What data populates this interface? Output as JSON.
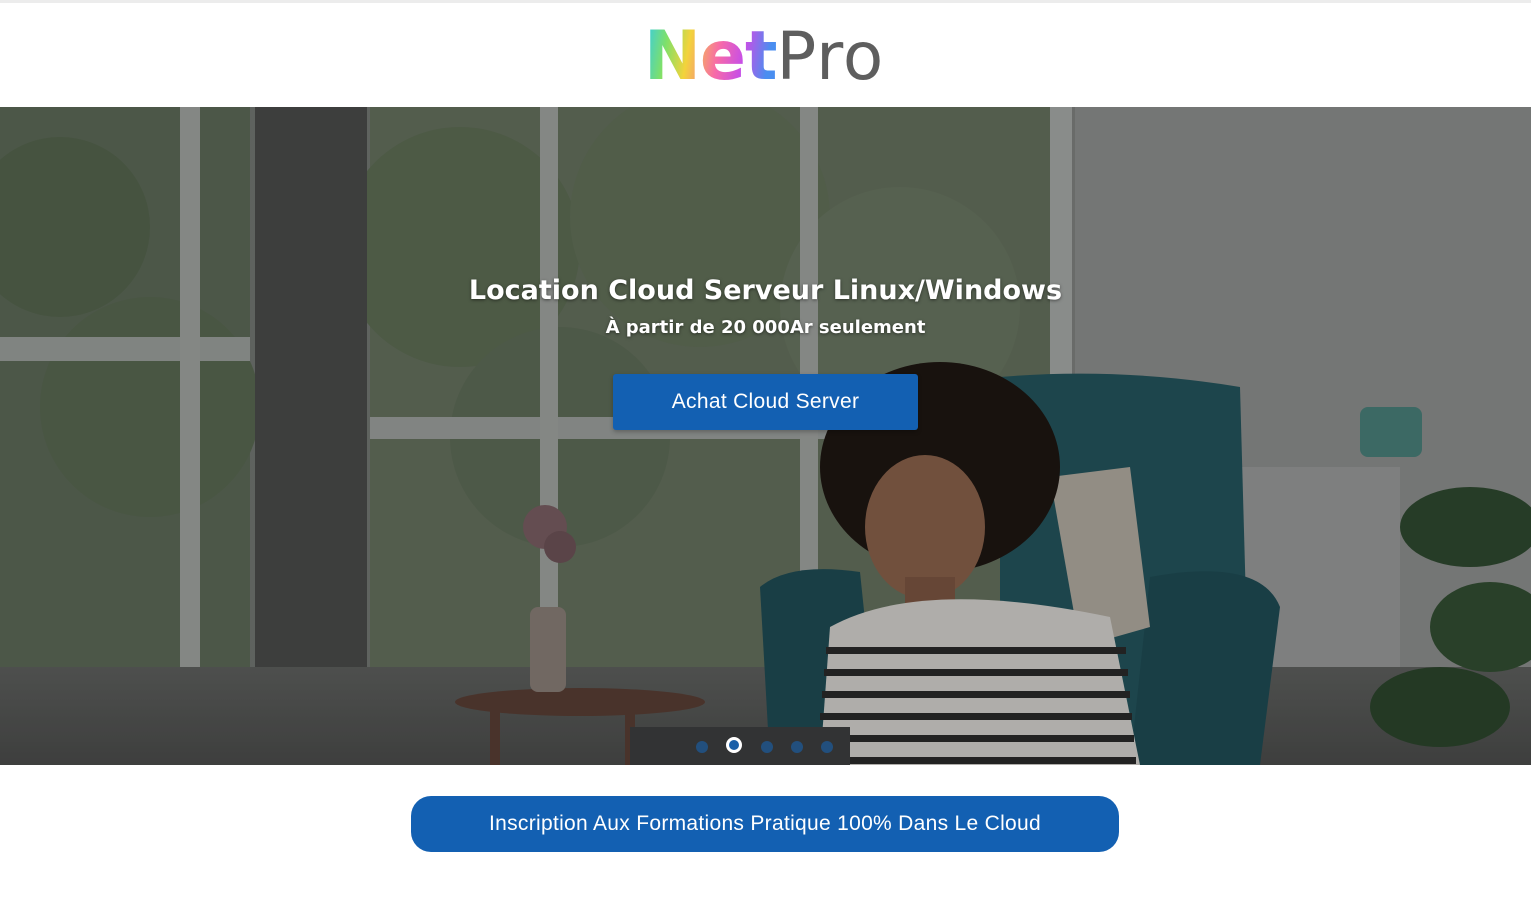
{
  "brand": {
    "logo_part1": "Net",
    "logo_part2": "Pro",
    "logo_colors": [
      "#2fc9f2",
      "#7ee06a",
      "#f3d33b",
      "#f76aa8",
      "#c84fe6",
      "#4a8ef0"
    ],
    "logo_pro_color": "#5e5e5e"
  },
  "hero": {
    "title": "Location Cloud Serveur Linux/Windows",
    "subtitle": "À partir de 20 000Ar seulement",
    "button_label": "Achat Cloud Server",
    "slider": {
      "total_slides": 5,
      "active_slide": 2
    }
  },
  "cta": {
    "label": "Inscription Aux Formations Pratique 100% Dans Le Cloud"
  },
  "colors": {
    "primary_blue": "#1360b2",
    "background": "#ffffff"
  }
}
